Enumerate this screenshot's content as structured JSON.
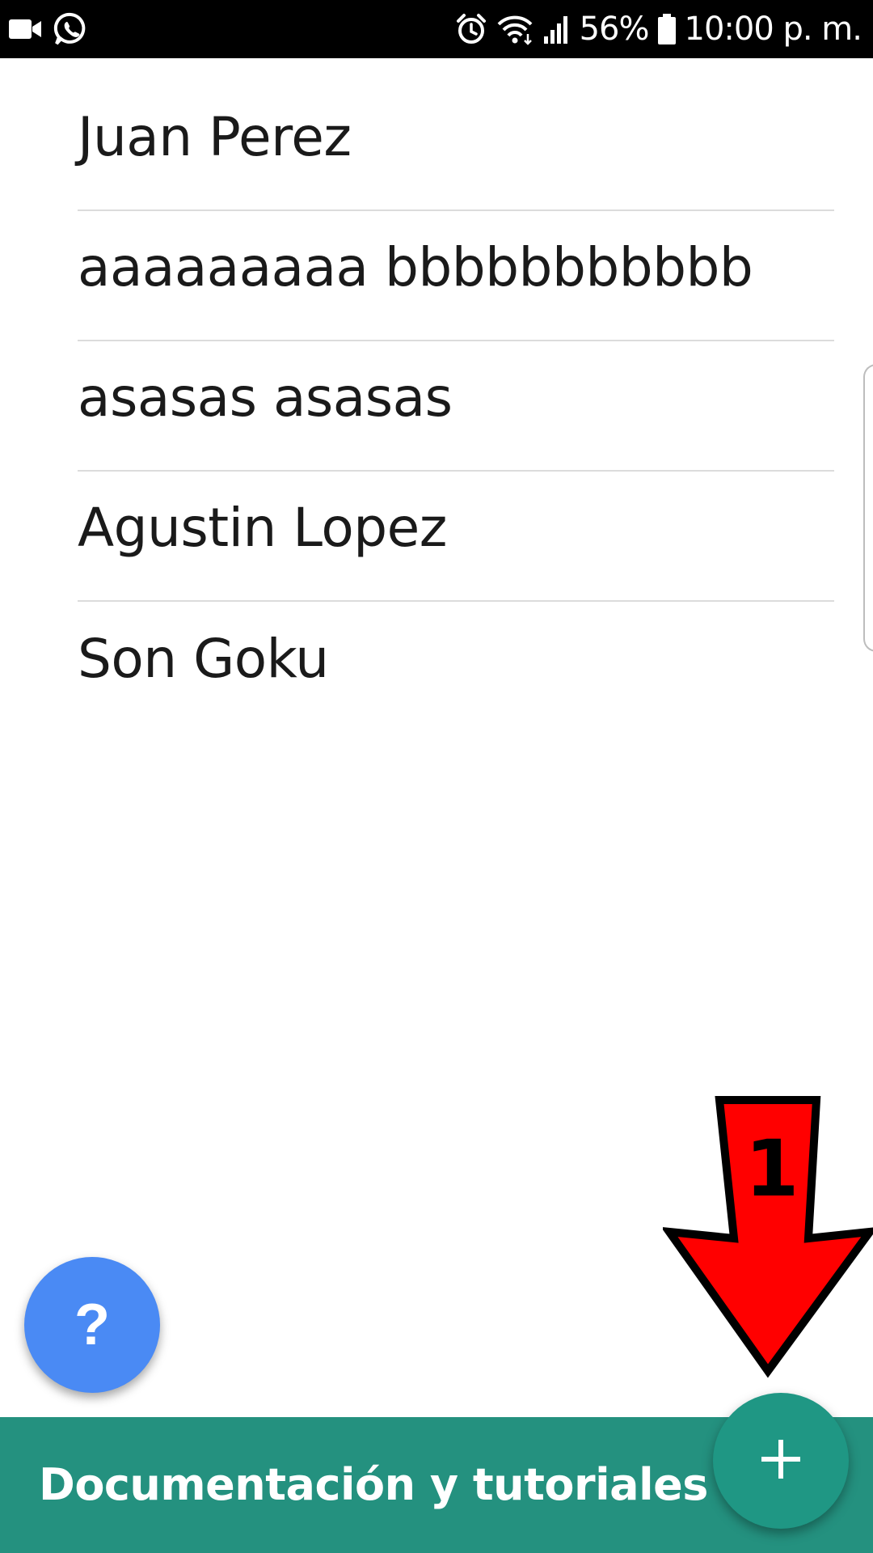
{
  "status_bar": {
    "battery_percent": "56%",
    "time": "10:00 p. m.",
    "icons": [
      "video-camera-icon",
      "whatsapp-icon",
      "alarm-icon",
      "wifi-icon",
      "signal-icon",
      "battery-icon"
    ]
  },
  "contacts": [
    {
      "name": "Juan Perez"
    },
    {
      "name": "aaaaaaaaa bbbbbbbbbbb"
    },
    {
      "name": "asasas asasas"
    },
    {
      "name": "Agustin Lopez"
    },
    {
      "name": "Son Goku"
    }
  ],
  "help_fab": {
    "label": "?",
    "color": "#4a8af4"
  },
  "bottom_bar": {
    "label": "Documentación y tutoriales",
    "color": "#24917f"
  },
  "add_fab": {
    "icon": "plus-icon",
    "color": "#1f9784"
  },
  "annotation": {
    "number": "1",
    "arrow_color": "#ff0000"
  }
}
